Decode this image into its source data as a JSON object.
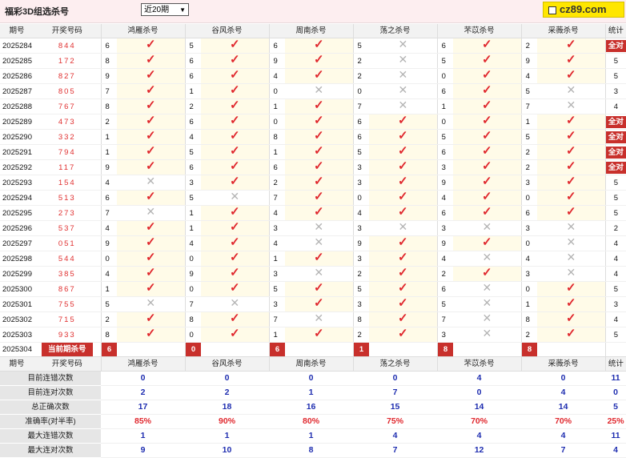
{
  "header": {
    "title": "福彩3D组选杀号",
    "period_select": "近20期",
    "logo": "cz89.com"
  },
  "columns": {
    "period": "期号",
    "draw": "开奖号码",
    "methods": [
      "鸿雁杀号",
      "谷风杀号",
      "周南杀号",
      "荡之杀号",
      "芣苡杀号",
      "采薇杀号"
    ],
    "stats": "统计"
  },
  "rows": [
    {
      "period": "2025284",
      "draw": "844",
      "nums": [
        "6",
        "5",
        "6",
        "5",
        "6",
        "2"
      ],
      "marks": [
        1,
        1,
        1,
        0,
        1,
        1
      ],
      "stat": "全对"
    },
    {
      "period": "2025285",
      "draw": "172",
      "nums": [
        "8",
        "6",
        "9",
        "2",
        "5",
        "9"
      ],
      "marks": [
        1,
        1,
        1,
        0,
        1,
        1
      ],
      "stat": "5"
    },
    {
      "period": "2025286",
      "draw": "827",
      "nums": [
        "9",
        "6",
        "4",
        "2",
        "0",
        "4"
      ],
      "marks": [
        1,
        1,
        1,
        0,
        1,
        1
      ],
      "stat": "5"
    },
    {
      "period": "2025287",
      "draw": "805",
      "nums": [
        "7",
        "1",
        "0",
        "0",
        "6",
        "5"
      ],
      "marks": [
        1,
        1,
        0,
        0,
        1,
        0
      ],
      "stat": "3"
    },
    {
      "period": "2025288",
      "draw": "767",
      "nums": [
        "8",
        "2",
        "1",
        "7",
        "1",
        "7"
      ],
      "marks": [
        1,
        1,
        1,
        0,
        1,
        0
      ],
      "stat": "4"
    },
    {
      "period": "2025289",
      "draw": "473",
      "nums": [
        "2",
        "6",
        "0",
        "6",
        "0",
        "1"
      ],
      "marks": [
        1,
        1,
        1,
        1,
        1,
        1
      ],
      "stat": "全对"
    },
    {
      "period": "2025290",
      "draw": "332",
      "nums": [
        "1",
        "4",
        "8",
        "6",
        "5",
        "5"
      ],
      "marks": [
        1,
        1,
        1,
        1,
        1,
        1
      ],
      "stat": "全对"
    },
    {
      "period": "2025291",
      "draw": "794",
      "nums": [
        "1",
        "5",
        "1",
        "5",
        "6",
        "2"
      ],
      "marks": [
        1,
        1,
        1,
        1,
        1,
        1
      ],
      "stat": "全对"
    },
    {
      "period": "2025292",
      "draw": "117",
      "nums": [
        "9",
        "6",
        "6",
        "3",
        "3",
        "2"
      ],
      "marks": [
        1,
        1,
        1,
        1,
        1,
        1
      ],
      "stat": "全对"
    },
    {
      "period": "2025293",
      "draw": "154",
      "nums": [
        "4",
        "3",
        "2",
        "3",
        "9",
        "3"
      ],
      "marks": [
        0,
        1,
        1,
        1,
        1,
        1
      ],
      "stat": "5"
    },
    {
      "period": "2025294",
      "draw": "513",
      "nums": [
        "6",
        "5",
        "7",
        "0",
        "4",
        "0"
      ],
      "marks": [
        1,
        0,
        1,
        1,
        1,
        1
      ],
      "stat": "5"
    },
    {
      "period": "2025295",
      "draw": "273",
      "nums": [
        "7",
        "1",
        "4",
        "4",
        "6",
        "6"
      ],
      "marks": [
        0,
        1,
        1,
        1,
        1,
        1
      ],
      "stat": "5"
    },
    {
      "period": "2025296",
      "draw": "537",
      "nums": [
        "4",
        "1",
        "3",
        "3",
        "3",
        "3"
      ],
      "marks": [
        1,
        1,
        0,
        0,
        0,
        0
      ],
      "stat": "2"
    },
    {
      "period": "2025297",
      "draw": "051",
      "nums": [
        "9",
        "4",
        "4",
        "9",
        "9",
        "0"
      ],
      "marks": [
        1,
        1,
        0,
        1,
        1,
        0
      ],
      "stat": "4"
    },
    {
      "period": "2025298",
      "draw": "544",
      "nums": [
        "0",
        "0",
        "1",
        "3",
        "4",
        "4"
      ],
      "marks": [
        1,
        1,
        1,
        1,
        0,
        0
      ],
      "stat": "4"
    },
    {
      "period": "2025299",
      "draw": "385",
      "nums": [
        "4",
        "9",
        "3",
        "2",
        "2",
        "3"
      ],
      "marks": [
        1,
        1,
        0,
        1,
        1,
        0
      ],
      "stat": "4"
    },
    {
      "period": "2025300",
      "draw": "867",
      "nums": [
        "1",
        "0",
        "5",
        "5",
        "6",
        "0"
      ],
      "marks": [
        1,
        1,
        1,
        1,
        0,
        1
      ],
      "stat": "5"
    },
    {
      "period": "2025301",
      "draw": "755",
      "nums": [
        "5",
        "7",
        "3",
        "3",
        "5",
        "1"
      ],
      "marks": [
        0,
        0,
        1,
        1,
        0,
        1
      ],
      "stat": "3"
    },
    {
      "period": "2025302",
      "draw": "715",
      "nums": [
        "2",
        "8",
        "7",
        "8",
        "7",
        "8"
      ],
      "marks": [
        1,
        1,
        0,
        1,
        0,
        1
      ],
      "stat": "4"
    },
    {
      "period": "2025303",
      "draw": "933",
      "nums": [
        "8",
        "0",
        "1",
        "2",
        "3",
        "2"
      ],
      "marks": [
        1,
        1,
        1,
        1,
        0,
        1
      ],
      "stat": "5"
    }
  ],
  "current": {
    "period": "2025304",
    "label": "当前期杀号",
    "nums": [
      "6",
      "0",
      "6",
      "1",
      "8",
      "8"
    ]
  },
  "summary": [
    {
      "label": "目前连错次数",
      "values": [
        "0",
        "0",
        "0",
        "0",
        "4",
        "0",
        "11"
      ],
      "red": false
    },
    {
      "label": "目前连对次数",
      "values": [
        "2",
        "2",
        "1",
        "7",
        "0",
        "4",
        "0"
      ],
      "red": false
    },
    {
      "label": "总正确次数",
      "values": [
        "17",
        "18",
        "16",
        "15",
        "14",
        "14",
        "5"
      ],
      "red": false
    },
    {
      "label": "准确率(对半率)",
      "values": [
        "85%",
        "90%",
        "80%",
        "75%",
        "70%",
        "70%",
        "25%"
      ],
      "red": true
    },
    {
      "label": "最大连错次数",
      "values": [
        "1",
        "1",
        "1",
        "4",
        "4",
        "4",
        "11"
      ],
      "red": false
    },
    {
      "label": "最大连对次数",
      "values": [
        "9",
        "10",
        "8",
        "7",
        "12",
        "7",
        "4"
      ],
      "red": false
    }
  ],
  "colors": {
    "accent": "#c8302c",
    "check": "#e0282e",
    "value": "#1f2eb0",
    "title_bar": "#fdeef0"
  },
  "icons": {
    "right": "check-icon",
    "wrong": "cross-icon"
  }
}
